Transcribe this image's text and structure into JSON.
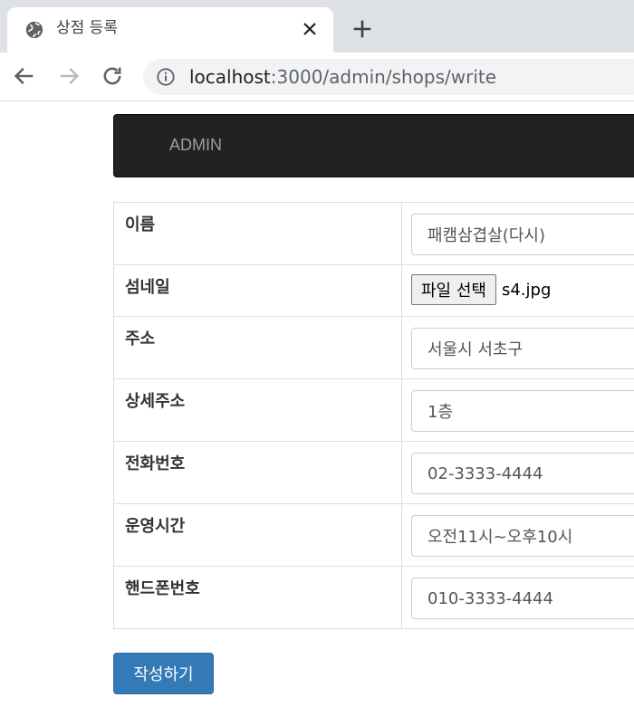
{
  "browser": {
    "tab_title": "상점 등록",
    "url_host": "localhost",
    "url_path": ":3000/admin/shops/write"
  },
  "navbar": {
    "brand": "ADMIN"
  },
  "form": {
    "rows": [
      {
        "label": "이름",
        "type": "text",
        "value": "패캠삼겹살(다시)"
      },
      {
        "label": "섬네일",
        "type": "file",
        "button": "파일 선택",
        "value": "s4.jpg"
      },
      {
        "label": "주소",
        "type": "text",
        "value": "서울시 서초구"
      },
      {
        "label": "상세주소",
        "type": "text",
        "value": "1층"
      },
      {
        "label": "전화번호",
        "type": "text",
        "value": "02-3333-4444"
      },
      {
        "label": "운영시간",
        "type": "text",
        "value": "오전11시~오후10시"
      },
      {
        "label": "핸드폰번호",
        "type": "text",
        "value": "010-3333-4444"
      }
    ],
    "submit_label": "작성하기"
  },
  "colors": {
    "navbar_bg": "#222222",
    "brand_text": "#9d9d9d",
    "primary_button": "#337ab7"
  }
}
